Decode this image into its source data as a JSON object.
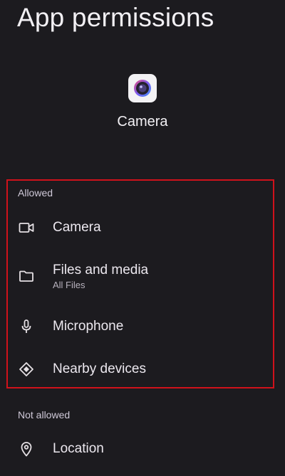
{
  "header": {
    "title": "App permissions"
  },
  "app": {
    "name": "Camera",
    "icon": "camera-app-icon"
  },
  "sections": {
    "allowed": {
      "label": "Allowed",
      "items": [
        {
          "label": "Camera",
          "icon": "videocam-icon"
        },
        {
          "label": "Files and media",
          "sublabel": "All Files",
          "icon": "folder-icon"
        },
        {
          "label": "Microphone",
          "icon": "microphone-icon"
        },
        {
          "label": "Nearby devices",
          "icon": "nearby-devices-icon"
        }
      ]
    },
    "not_allowed": {
      "label": "Not allowed",
      "items": [
        {
          "label": "Location",
          "icon": "location-icon"
        }
      ]
    }
  },
  "colors": {
    "background": "#1c1b1f",
    "highlight": "#d0121b",
    "text_primary": "#ece8ef",
    "text_secondary": "#b7b2bd"
  }
}
